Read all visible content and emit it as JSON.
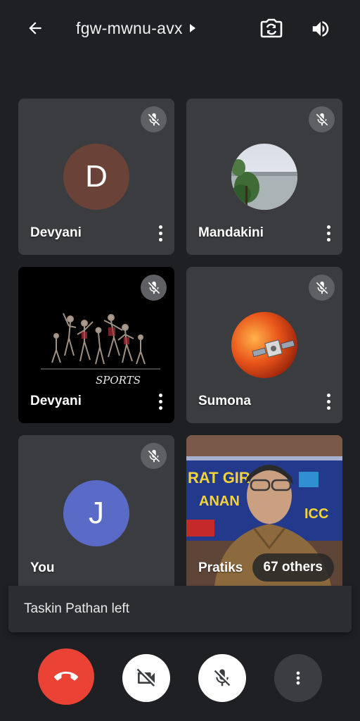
{
  "header": {
    "meeting_code": "fgw-mwnu-avx",
    "icons": [
      "back-arrow-icon",
      "caret-right-icon",
      "switch-camera-icon",
      "speaker-icon"
    ]
  },
  "participants": [
    {
      "name": "Devyani",
      "avatar_letter": "D",
      "avatar_color": "#6b4237",
      "muted": true
    },
    {
      "name": "Mandakini",
      "avatar_kind": "photo-landscape",
      "muted": true
    },
    {
      "name": "Devyani",
      "tile_kind": "video-sports",
      "video_text": "SPORTS",
      "muted": true
    },
    {
      "name": "Sumona",
      "avatar_kind": "photo-sun-satellite",
      "muted": true
    },
    {
      "name": "You",
      "avatar_letter": "J",
      "avatar_color": "#5a6bc7",
      "muted": true
    },
    {
      "name": "Pratiks",
      "tile_kind": "video-person",
      "banner_lines": [
        "RAT GIR",
        "ANAN",
        "ICC"
      ]
    }
  ],
  "others_label": "67 others",
  "toast": {
    "message": "Taskin Pathan left"
  },
  "controls": {
    "end_call_color": "#ea4335",
    "icons": [
      "end-call-icon",
      "camera-off-icon",
      "mic-off-icon",
      "more-vert-icon"
    ]
  }
}
